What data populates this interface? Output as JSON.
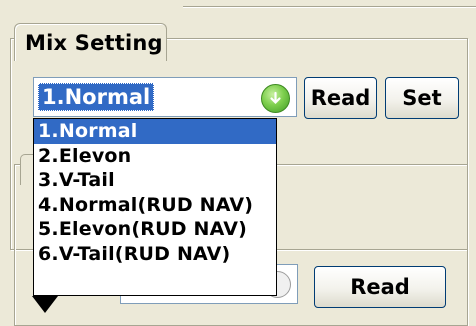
{
  "mix_setting": {
    "group_title": "Mix Setting",
    "selected_value": "1.Normal",
    "read_label": "Read",
    "set_label": "Set",
    "options": [
      "1.Normal",
      "2.Elevon",
      "3.V-Tail",
      "4.Normal(RUD NAV)",
      "5.Elevon(RUD NAV)",
      "6.V-Tail(RUD NAV)"
    ],
    "highlighted_index": 0
  },
  "lower_group": {
    "read_label": "Read"
  },
  "icons": {
    "combo_button": "green-down-arrow-icon",
    "pointer": "down-triangle-icon"
  },
  "colors": {
    "selection": "#316ac5",
    "background": "#ece9d8",
    "combo_button": "#7ecf4e"
  }
}
